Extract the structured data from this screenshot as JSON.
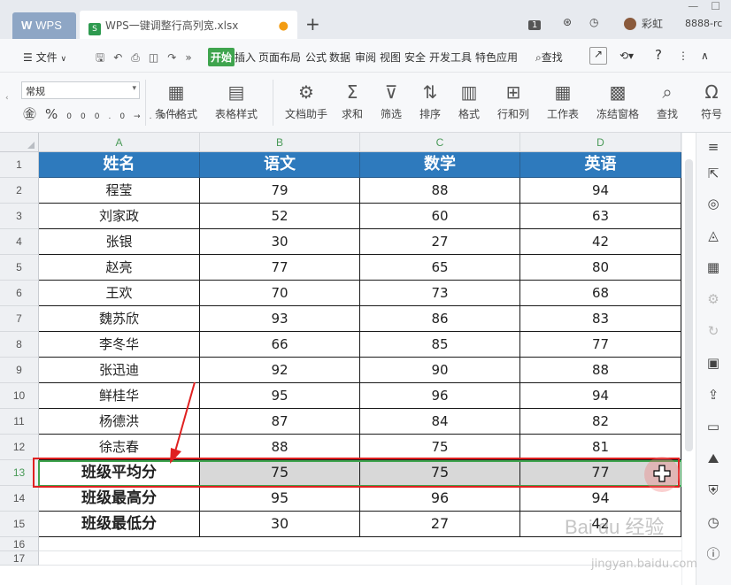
{
  "titlebar": {
    "app_tab": "WPS",
    "doc_tab": "WPS一键调整行高列宽.xlsx",
    "page_badge": "1",
    "user": "彩虹",
    "account": "8888-rc"
  },
  "menubar": {
    "file": "文件",
    "tabs": [
      "开始",
      "插入",
      "页面布局",
      "公式",
      "数据",
      "审阅",
      "视图",
      "安全",
      "开发工具",
      "特色应用"
    ],
    "search": "查找"
  },
  "ribbon": {
    "number_format": "常规",
    "buttons": [
      "条件格式",
      "表格样式",
      "文档助手",
      "求和",
      "筛选",
      "排序",
      "格式",
      "行和列",
      "工作表",
      "冻结窗格",
      "查找",
      "符号"
    ]
  },
  "sheet": {
    "columns": [
      "A",
      "B",
      "C",
      "D"
    ],
    "row_numbers": [
      "1",
      "2",
      "3",
      "4",
      "5",
      "6",
      "7",
      "8",
      "9",
      "10",
      "11",
      "12",
      "13",
      "14",
      "15",
      "16",
      "17"
    ],
    "header": [
      "姓名",
      "语文",
      "数学",
      "英语"
    ],
    "rows": [
      [
        "程莹",
        "79",
        "88",
        "94"
      ],
      [
        "刘家政",
        "52",
        "60",
        "63"
      ],
      [
        "张银",
        "30",
        "27",
        "42"
      ],
      [
        "赵亮",
        "77",
        "65",
        "80"
      ],
      [
        "王欢",
        "70",
        "73",
        "68"
      ],
      [
        "魏苏欣",
        "93",
        "86",
        "83"
      ],
      [
        "李冬华",
        "66",
        "85",
        "77"
      ],
      [
        "张迅迪",
        "92",
        "90",
        "88"
      ],
      [
        "鲜桂华",
        "95",
        "96",
        "94"
      ],
      [
        "杨德洪",
        "87",
        "84",
        "82"
      ],
      [
        "徐志春",
        "88",
        "75",
        "81"
      ]
    ],
    "summary_rows": [
      [
        "班级平均分",
        "75",
        "75",
        "77"
      ],
      [
        "班级最高分",
        "95",
        "96",
        "94"
      ],
      [
        "班级最低分",
        "30",
        "27",
        "42"
      ]
    ],
    "selected_row": "13"
  },
  "watermark": {
    "text": "Bai du 经验",
    "url": "jingyan.baidu.com"
  },
  "colors": {
    "header_fill": "#2e7abd",
    "active_tab": "#3fa44e",
    "annotation_red": "#e02020"
  }
}
